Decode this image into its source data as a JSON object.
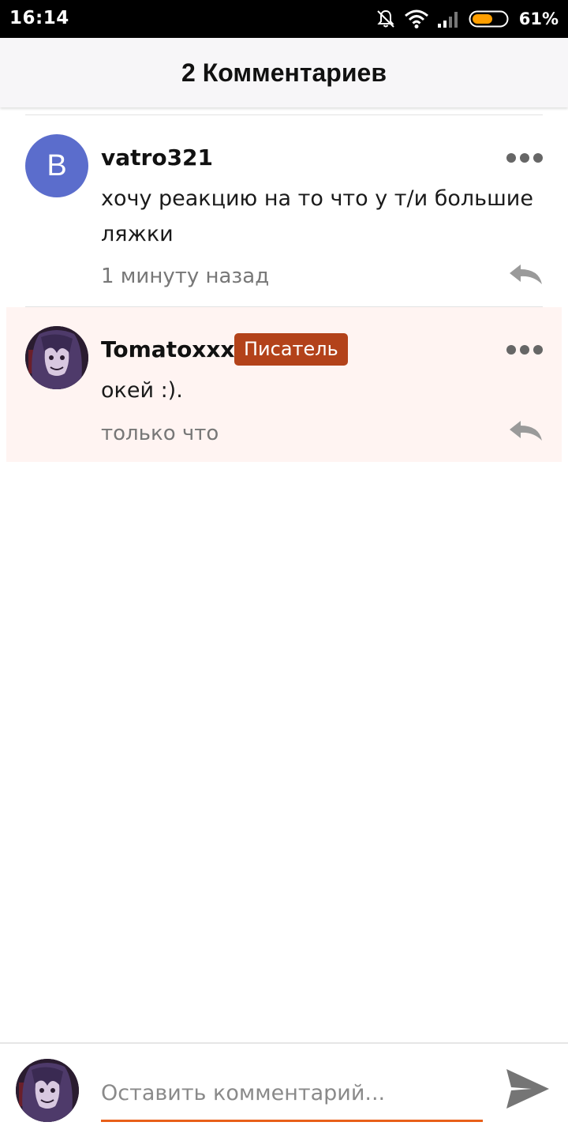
{
  "status_bar": {
    "time": "16:14",
    "battery_percent": "61%",
    "battery_level": 0.61,
    "icons": [
      "notifications-off-icon",
      "wifi-icon",
      "signal-icon",
      "battery-icon"
    ],
    "battery_color": "#ff9f00"
  },
  "header": {
    "title": "2 Комментариев"
  },
  "comments": [
    {
      "avatar_letter": "В",
      "avatar_color": "#5b6dcc",
      "username": "vatro321",
      "text": "хочу реакцию на то что у т/и большие ляжки",
      "time": "1 минуту назад",
      "icons": [
        "more-icon",
        "reply-icon"
      ]
    },
    {
      "avatar": "user-avatar-image",
      "username": "Tomatoxxx",
      "badge": "Писатель",
      "badge_color": "#b3421a",
      "text": "окей :).",
      "time": "только что",
      "highlight_color": "#fff4f2",
      "icons": [
        "more-icon",
        "reply-icon"
      ]
    }
  ],
  "composer": {
    "placeholder": "Оставить комментарий...",
    "accent_color": "#e8601a",
    "icons": [
      "user-avatar-image",
      "send-icon"
    ]
  }
}
